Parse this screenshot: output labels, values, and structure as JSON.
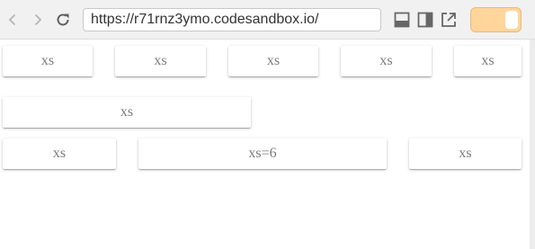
{
  "browser": {
    "url": "https://r71rnz3ymo.codesandbox.io/",
    "back_icon": "chevron-left-icon",
    "forward_icon": "chevron-right-icon",
    "reload_icon": "reload-icon",
    "icons": [
      "dock-bottom-icon",
      "dock-side-icon",
      "open-external-icon"
    ],
    "toggle_color": "#ffd59c"
  },
  "grid": {
    "row1": [
      "xs",
      "xs",
      "xs",
      "xs",
      "xs"
    ],
    "row2": [
      "xs"
    ],
    "row3": [
      "xs",
      "xs=6",
      "xs"
    ]
  }
}
